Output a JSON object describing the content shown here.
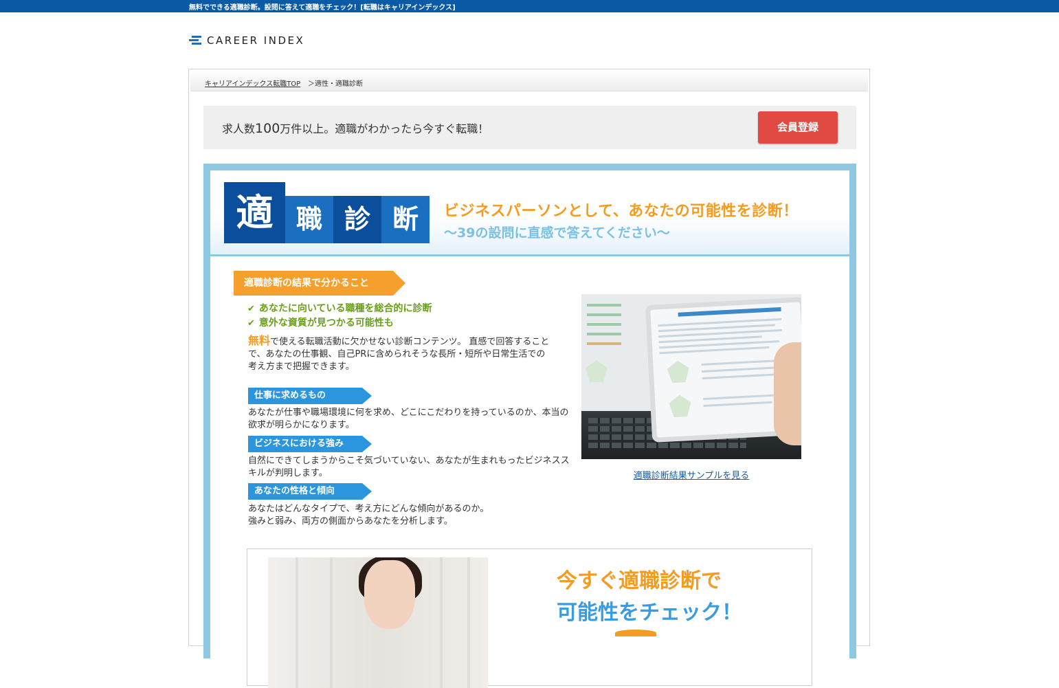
{
  "topbar": {
    "text": "無料でできる適職診断。設問に答えて適職をチェック！[転職はキャリアインデックス]"
  },
  "logo": {
    "text": "CAREER INDEX"
  },
  "breadcrumb": {
    "home": "キャリアインデックス転職TOP",
    "current": "＞適性・適職診断"
  },
  "banner": {
    "text_before": "求人数",
    "text_number": "100",
    "text_after": "万件以上。適職がわかったら今すぐ転職！",
    "register_label": "会員登録"
  },
  "hero": {
    "k1": "適",
    "k2": "職",
    "k3": "診",
    "k4": "断",
    "headline": "ビジネスパーソンとして、あなたの可能性を診断！",
    "subline": "～39の設問に直感で答えてください～"
  },
  "results": {
    "tag": "適職診断の結果で分かること",
    "checks": [
      "あなたに向いている職種を総合的に診断",
      "意外な資質が見つかる可能性も"
    ],
    "free": "無料",
    "description": "で使える転職活動に欠かせない診断コンテンツ。 直感で回答することで、あなたの仕事観、自己PRに含められそうな長所・短所や日常生活での考え方まで把握できます。",
    "sections": [
      {
        "title": "仕事に求めるもの",
        "text": "あなたが仕事や職場環境に何を求め、どこにこだわりを持っているのか、本当の欲求が明らかになります。"
      },
      {
        "title": "ビジネスにおける強み",
        "text": "自然にできてしまうからこそ気づいていない、あなたが生まれもったビジネススキルが判明します。"
      },
      {
        "title": "あなたの性格と傾向",
        "text": "あなたはどんなタイプで、考え方にどんな傾向があるのか。\n強みと弱み、両方の側面からあなたを分析します。"
      }
    ],
    "sample_link": "適職診断結果サンプルを見る"
  },
  "cta": {
    "line1": "今すぐ適職診断で",
    "line2": "可能性をチェック！"
  },
  "colors": {
    "topbar": "#0b5aa6",
    "register": "#e04a42",
    "accent_orange": "#f39c21",
    "accent_blue": "#2b96dd",
    "frame_blue": "#8ec8e3",
    "check_green": "#6a9f1a"
  },
  "icons": [
    "logo-mark-icon",
    "check-icon"
  ]
}
